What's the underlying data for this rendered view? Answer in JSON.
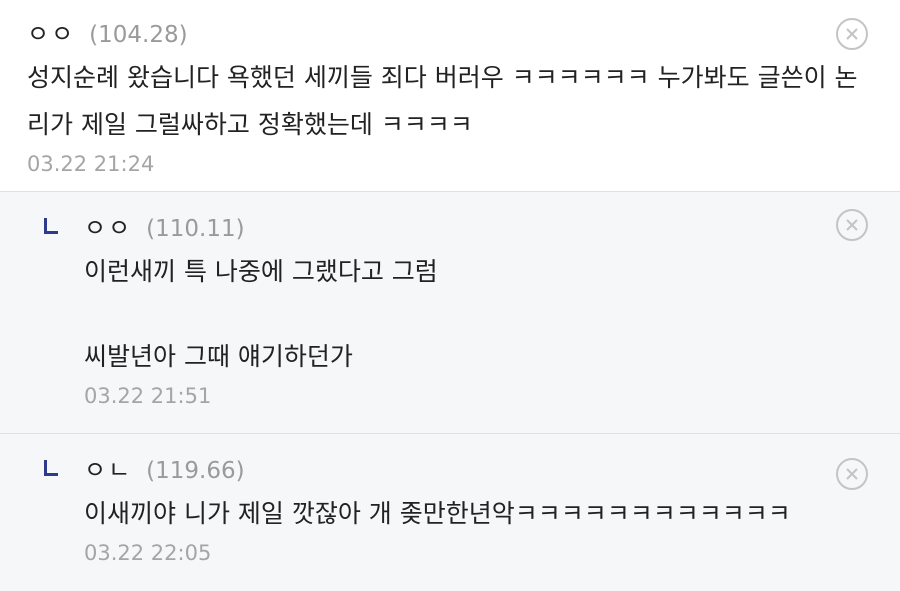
{
  "comments": [
    {
      "nick": "ㅇㅇ",
      "ip": "(104.28)",
      "text": "성지순례 왔습니다 욕했던 세끼들 죄다 버러우 ㅋㅋㅋㅋㅋㅋ 누가봐도 글쓴이 논리가 제일 그럴싸하고 정확했는데 ㅋㅋㅋㅋ",
      "time": "03.22 21:24"
    },
    {
      "nick": "ㅇㅇ",
      "ip": "(110.11)",
      "text_line1": "이런새끼 특 나중에 그랬다고 그럼",
      "text_line2": "씨발년아 그때 얘기하던가",
      "time": "03.22 21:51"
    },
    {
      "nick": "ㅇㄴ",
      "ip": "(119.66)",
      "text": "이새끼야 니가 제일 깟잖아 개 좆만한년악ㅋㅋㅋㅋㅋㅋㅋㅋㅋㅋㅋㅋ",
      "time": "03.22 22:05"
    }
  ],
  "icons": {
    "delete": "close-circle-icon",
    "reply": "reply-arrow-icon"
  },
  "colors": {
    "reply_arrow": "#2e3a8c",
    "reply_bg": "#f6f7f9",
    "muted": "#9a9a9a"
  }
}
